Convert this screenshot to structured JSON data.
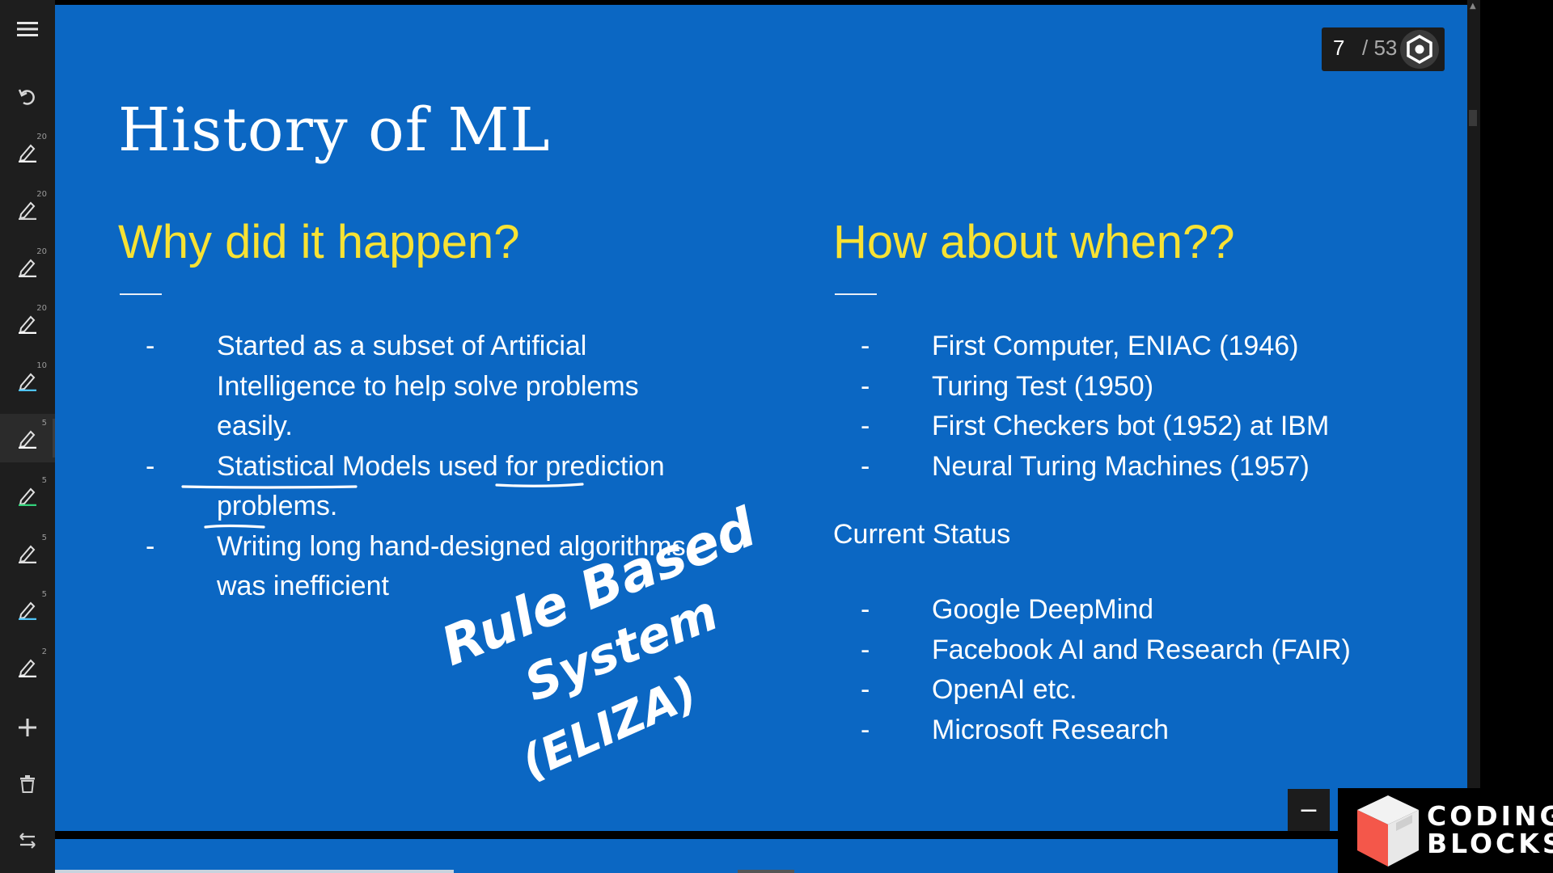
{
  "slide": {
    "title": "History of ML",
    "left": {
      "heading": "Why did it happen?",
      "bullets": [
        [
          "Started as a subset of Artificial",
          "Intelligence to help solve problems",
          "easily."
        ],
        [
          "Statistical Models used for prediction",
          "problems."
        ],
        [
          "Writing long hand-designed algorithms",
          "was inefficient"
        ]
      ]
    },
    "right": {
      "heading": "How about when??",
      "bullets": [
        "First Computer, ENIAC (1946)",
        "Turing Test (1950)",
        "First Checkers bot (1952) at IBM",
        "Neural Turing Machines (1957)"
      ],
      "status_label": "Current Status",
      "status_bullets": [
        "Google DeepMind",
        "Facebook AI and Research (FAIR)",
        "OpenAI etc.",
        "Microsoft Research"
      ]
    },
    "bullet_marker": "-",
    "handwriting": {
      "line1": "Rule Based",
      "line2": "System",
      "line3": "(ELIZA)"
    },
    "colors": {
      "background": "#0b67c3",
      "heading": "#f8e233",
      "text": "#ffffff",
      "ink": "#ffffff"
    }
  },
  "counter": {
    "current": "7",
    "total": "/ 53"
  },
  "toolbar": {
    "icons": [
      "menu-icon",
      "undo-icon",
      "pen-icon",
      "pen-icon",
      "pen-icon",
      "pen-icon",
      "pen-icon",
      "pen-icon",
      "pen-icon",
      "pen-icon",
      "pen-icon",
      "pen-icon",
      "plus-icon",
      "trash-icon",
      "swap-icon"
    ],
    "pen_sizes": [
      "20",
      "20",
      "20",
      "20",
      "10",
      "5",
      "5",
      "5",
      "5",
      "2"
    ],
    "pen_colors": [
      "#ffffff",
      "#cfcfcf",
      "#e6e6e6",
      "#ffffff",
      "#4fc3f7",
      "#ffffff",
      "#33d17a",
      "#e0e0e0",
      "#4fc3f7",
      "#ffffff"
    ],
    "active_pen": 5
  },
  "logo": {
    "line1": "CODING",
    "line2": "BLOCKS"
  },
  "minus_label": "−"
}
